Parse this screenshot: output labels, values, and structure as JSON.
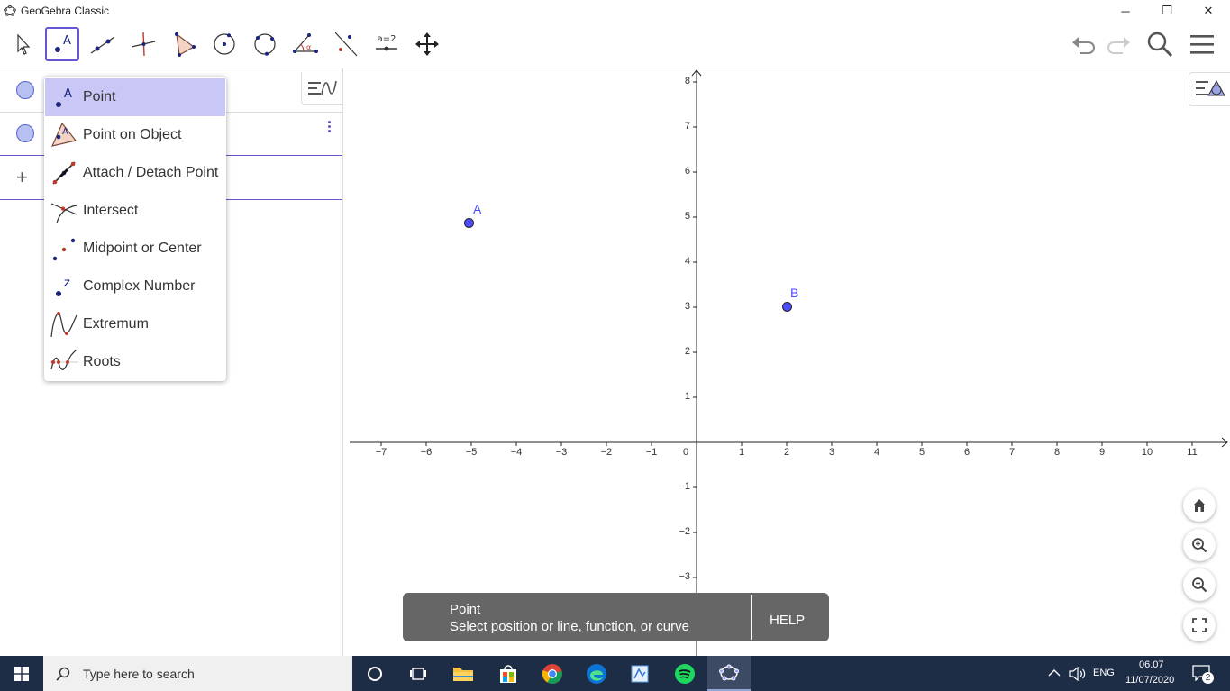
{
  "window": {
    "title": "GeoGebra Classic",
    "minimize": "─",
    "restore": "❐",
    "close": "✕"
  },
  "toolbar": {
    "tools": [
      "move-tool",
      "point-tool",
      "line-tool",
      "perpendicular-line-tool",
      "polygon-tool",
      "circle-center-tool",
      "circle-three-points-tool",
      "angle-tool",
      "reflect-tool",
      "slider-tool",
      "move-graphics-view-tool"
    ],
    "slider_label": "a = 2"
  },
  "algebra": {
    "plus": "+"
  },
  "tool_dropdown": {
    "items": [
      {
        "label": "Point",
        "icon": "point-icon"
      },
      {
        "label": "Point on Object",
        "icon": "point-on-object-icon"
      },
      {
        "label": "Attach / Detach Point",
        "icon": "attach-detach-icon"
      },
      {
        "label": "Intersect",
        "icon": "intersect-icon"
      },
      {
        "label": "Midpoint or Center",
        "icon": "midpoint-icon"
      },
      {
        "label": "Complex Number",
        "icon": "complex-number-icon"
      },
      {
        "label": "Extremum",
        "icon": "extremum-icon"
      },
      {
        "label": "Roots",
        "icon": "roots-icon"
      }
    ],
    "selected": "Point"
  },
  "graphics": {
    "x_ticks": [
      "−7",
      "−6",
      "−5",
      "−4",
      "−3",
      "−2",
      "−1",
      "0",
      "1",
      "2",
      "3",
      "4",
      "5",
      "6",
      "7",
      "8",
      "9",
      "10",
      "11"
    ],
    "y_ticks": [
      "8",
      "7",
      "6",
      "5",
      "4",
      "3",
      "2",
      "1",
      "−1",
      "−2",
      "−3",
      "−4"
    ],
    "points": [
      {
        "label": "A",
        "x": -5,
        "y": 4.85
      },
      {
        "label": "B",
        "x": 2,
        "y": 3
      }
    ]
  },
  "snackbar": {
    "title": "Point",
    "description": "Select position or line, function, or curve",
    "help": "HELP"
  },
  "taskbar": {
    "search_placeholder": "Type here to search",
    "language": "ENG",
    "time": "06.07",
    "date": "11/07/2020",
    "notifications": "2"
  }
}
